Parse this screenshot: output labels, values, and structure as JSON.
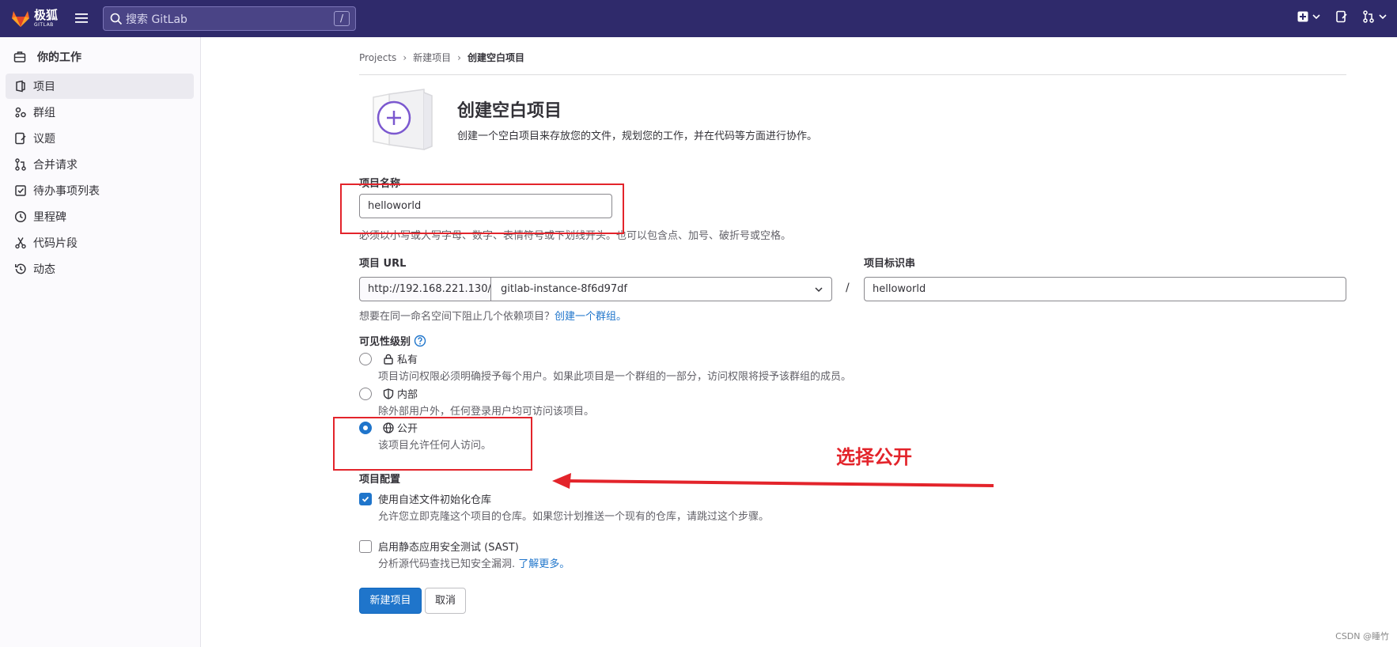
{
  "navbar": {
    "brand_main": "极狐",
    "brand_sub": "GITLAB",
    "search_placeholder": "搜索 GitLab",
    "search_shortcut": "/",
    "icons": [
      "new-item-icon",
      "issues-icon",
      "merge-requests-icon"
    ]
  },
  "sidebar": {
    "header": "你的工作",
    "items": [
      {
        "label": "项目",
        "icon": "project-icon",
        "active": true
      },
      {
        "label": "群组",
        "icon": "group-icon"
      },
      {
        "label": "议题",
        "icon": "issues-icon"
      },
      {
        "label": "合并请求",
        "icon": "merge-request-icon"
      },
      {
        "label": "待办事项列表",
        "icon": "todo-icon"
      },
      {
        "label": "里程碑",
        "icon": "clock-icon"
      },
      {
        "label": "代码片段",
        "icon": "snippet-icon"
      },
      {
        "label": "动态",
        "icon": "history-icon"
      }
    ]
  },
  "breadcrumb": {
    "items": [
      "Projects",
      "新建项目",
      "创建空白项目"
    ]
  },
  "page": {
    "title": "创建空白项目",
    "description": "创建一个空白项目来存放您的文件，规划您的工作，并在代码等方面进行协作。"
  },
  "form": {
    "name_label": "项目名称",
    "name_value": "helloworld",
    "name_help": "必须以小写或大写字母、数字、表情符号或下划线开头。也可以包含点、加号、破折号或空格。",
    "url_label": "项目 URL",
    "url_prefix": "http://192.168.221.130/",
    "url_namespace": "gitlab-instance-8f6d97df",
    "url_separator": "/",
    "slug_label": "项目标识串",
    "slug_value": "helloworld",
    "group_help": "想要在同一命名空间下阻止几个依赖项目？",
    "group_link": "创建一个群组。",
    "visibility_label": "可见性级别",
    "visibility_options": [
      {
        "label": "私有",
        "desc": "项目访问权限必须明确授予每个用户。如果此项目是一个群组的一部分，访问权限将授予该群组的成员。",
        "icon": "lock-icon",
        "selected": false
      },
      {
        "label": "内部",
        "desc": "除外部用户外，任何登录用户均可访问该项目。",
        "icon": "shield-icon",
        "selected": false
      },
      {
        "label": "公开",
        "desc": "该项目允许任何人访问。",
        "icon": "globe-icon",
        "selected": true
      }
    ],
    "config_label": "项目配置",
    "readme_label": "使用自述文件初始化仓库",
    "readme_checked": true,
    "readme_help": "允许您立即克隆这个项目的仓库。如果您计划推送一个现有的仓库，请跳过这个步骤。",
    "sast_label": "启用静态应用安全测试 (SAST)",
    "sast_checked": false,
    "sast_help": "分析源代码查找已知安全漏洞.",
    "sast_link": "了解更多。",
    "submit_label": "新建项目",
    "cancel_label": "取消"
  },
  "annotation": {
    "text": "选择公开",
    "color": "#e3242b"
  },
  "watermark": "CSDN @睡竹",
  "colors": {
    "navbar": "#2f2a6b",
    "primary": "#1f75cb",
    "annotation": "#e3242b"
  }
}
